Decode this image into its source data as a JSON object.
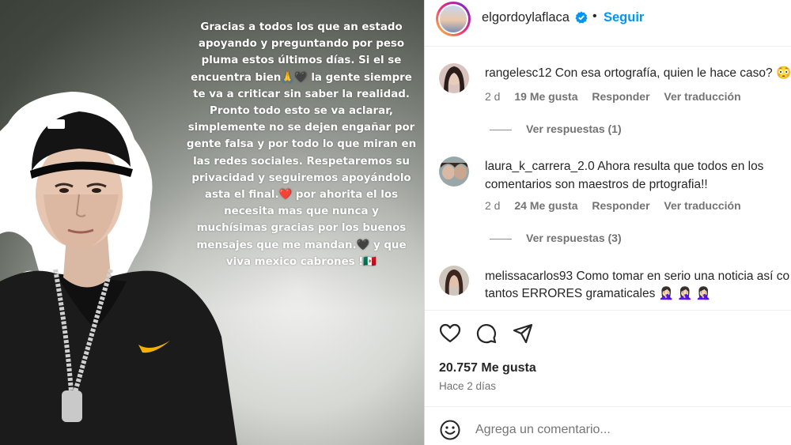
{
  "story": {
    "lines": [
      "Gracias a todos los que an estado",
      "apoyando y preguntando por peso",
      "pluma estos últimos días. Si el se",
      "encuentra bien🙏🖤 la gente siempre",
      "te va a criticar sin saber la realidad.",
      "Pronto todo esto se va aclarar,",
      "simplemente no se dejen engañar por",
      "gente falsa y por todo lo que miran en",
      "las redes sociales. Respetaremos su",
      "privacidad y seguiremos apoyándolo",
      "asta el final.❤️ por ahorita el los",
      "necesita mas que nunca y",
      "muchísimas gracias por los buenos",
      "mensajes que me mandan.🖤 y que",
      "viva mexico cabrones !🇲🇽"
    ]
  },
  "header": {
    "username": "elgordoylaflaca",
    "separator": "•",
    "follow_label": "Seguir"
  },
  "comments": [
    {
      "username": "rangelesc12",
      "text": "Con esa ortografía, quien le hace caso? 😳",
      "time": "2 d",
      "likes": "19 Me gusta",
      "reply": "Responder",
      "translate": "Ver traducción",
      "replies": "Ver respuestas (1)"
    },
    {
      "username": "laura_k_carrera_2.0",
      "text": "Ahora resulta que todos en los",
      "text2": "comentarios son maestros de prtografia!!",
      "time": "2 d",
      "likes": "24 Me gusta",
      "reply": "Responder",
      "translate": "Ver traducción",
      "replies": "Ver respuestas (3)"
    },
    {
      "username": "melissacarlos93",
      "text": "Como tomar en serio una noticia así con",
      "text2": "tantos ERRORES gramaticales 🤦🏻‍♀️ 🤦🏻‍♀️ 🤦🏻‍♀️"
    }
  ],
  "post": {
    "likes_total": "20.757 Me gusta",
    "time_ago": "Hace 2 días",
    "comment_placeholder": "Agrega un comentario..."
  },
  "icons": {
    "like": "heart-icon",
    "comment": "comment-icon",
    "share": "share-icon",
    "emoji": "emoji-icon",
    "verified": "verified-badge-icon"
  },
  "colors": {
    "link_blue": "#0095f6",
    "verified_blue": "#0095f6",
    "text": "#262626",
    "muted": "#737373"
  }
}
